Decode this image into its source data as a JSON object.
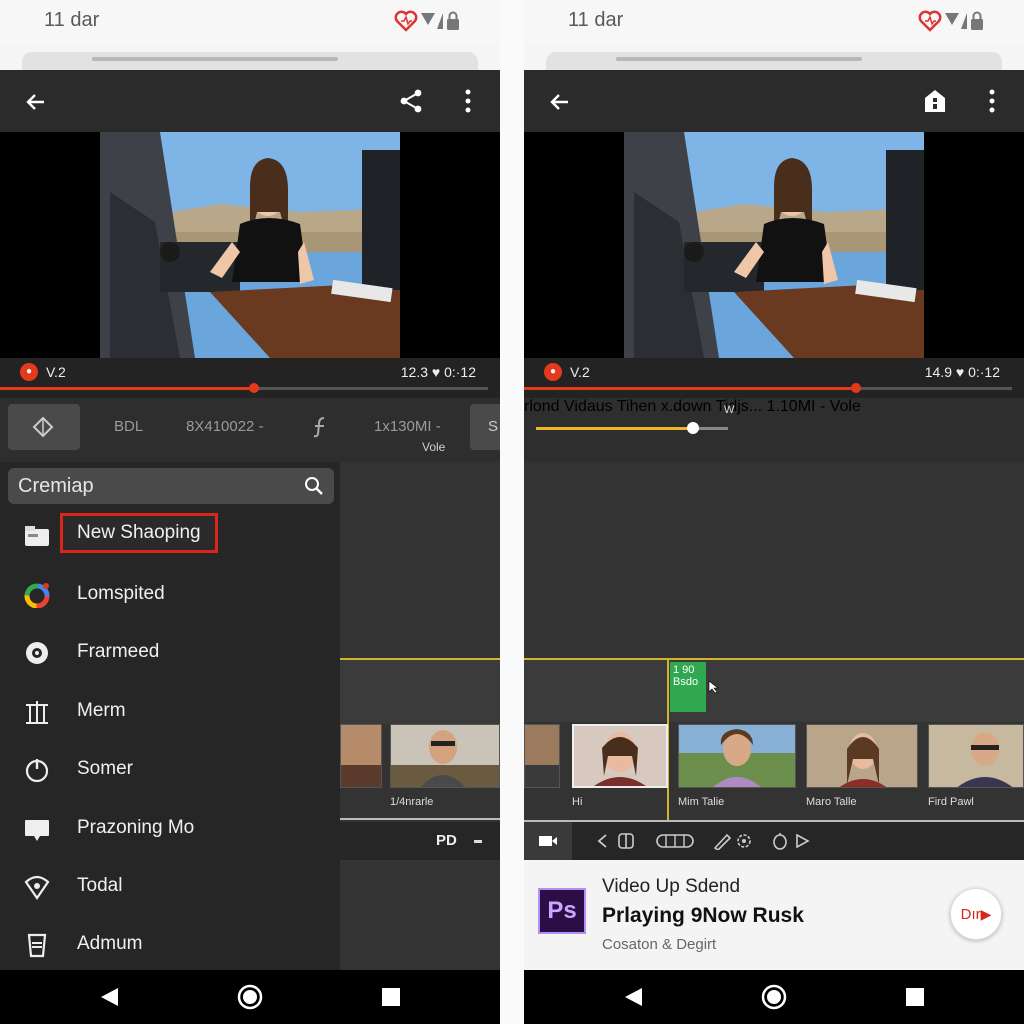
{
  "colors": {
    "accent": "#e23a1b",
    "highlight": "#d9261c",
    "timeline": "#d4b42a",
    "clip": "#2fa84f",
    "appbar": "#2b2b2b"
  },
  "left": {
    "status_time": "11 dar",
    "version_label": "V.2",
    "time_display": "12.3 ♥ 0:·12",
    "progress": 0.52,
    "toolbar": {
      "t1": "BDL",
      "t2": "8X410022 -",
      "t3": "1x130MI -",
      "t4": "S",
      "sublabel": "Vole"
    },
    "search": {
      "value": "Cremiap"
    },
    "menu": [
      {
        "label": "New Shaoping",
        "icon": "card-icon"
      },
      {
        "label": "Lomspited",
        "icon": "google-icon"
      },
      {
        "label": "Frarmeed",
        "icon": "frame-icon"
      },
      {
        "label": "Merm",
        "icon": "grid-icon"
      },
      {
        "label": "Somer",
        "icon": "power-icon"
      },
      {
        "label": "Prazoning Mo",
        "icon": "comment-icon"
      },
      {
        "label": "Todal",
        "icon": "wifi-icon"
      },
      {
        "label": "Admum",
        "icon": "cup-icon"
      }
    ],
    "timeline_label": "1/4nrarle",
    "footer_label": "PD"
  },
  "right": {
    "status_time": "11 dar",
    "version_label": "V.2",
    "time_display": "14.9 ♥ 0:·12",
    "progress": 0.68,
    "toolbar": {
      "w": "W",
      "t1": "x.down",
      "t2": "Tidjs...",
      "t3": "1.10MI -",
      "sublabel": "Vole",
      "sl1": "rlond",
      "sl2": "Vidaus",
      "sl3": "Tihen"
    },
    "slider": 0.82,
    "clip": {
      "l1": "1 90",
      "l2": "Bsdo"
    },
    "thumbs": [
      {
        "label": ""
      },
      {
        "label": "Hi"
      },
      {
        "label": "Mim Talie"
      },
      {
        "label": "Maro Talle"
      },
      {
        "label": "Fird Pawl"
      }
    ],
    "ad": {
      "logo": "Ps",
      "line1": "Video Up Sdend",
      "line2": "Prlaying 9Now Rusk",
      "line3": "Cosaton & Degirt",
      "cta": "Dır"
    }
  }
}
